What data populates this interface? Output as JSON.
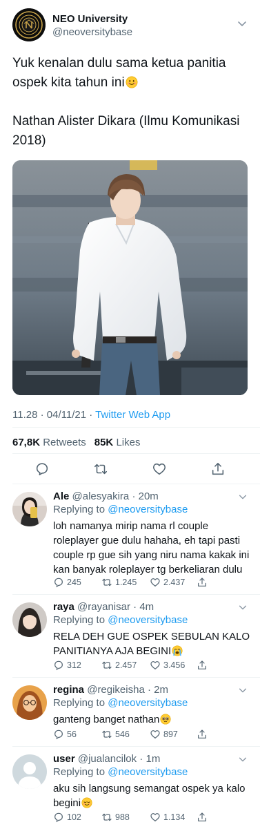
{
  "tweet": {
    "author_name": "NEO University",
    "author_handle": "@neoversitybase",
    "text_line1": "Yuk kenalan dulu sama ketua panitia ospek kita tahun ini",
    "text_line2": "Nathan Alister Dikara (Ilmu Komunikasi 2018)",
    "emoji1": "smiling-face-emoji",
    "time": "11.28",
    "date": "04/11/21",
    "app": "Twitter Web App",
    "retweets": "67,8K",
    "retweets_label": "Retweets",
    "likes": "85K",
    "likes_label": "Likes",
    "action_icons": [
      "reply-icon",
      "retweet-icon",
      "like-icon",
      "share-icon"
    ]
  },
  "replies": [
    {
      "name": "Ale",
      "handle": "@alesyakira",
      "time": "20m",
      "replying_prefix": "Replying to",
      "replying_to": "@neoversitybase",
      "text": "loh namanya mirip nama rl couple roleplayer gue dulu hahaha, eh tapi pasti couple rp gue sih yang niru nama kakak ini kan banyak roleplayer tg berkeliaran dulu",
      "emoji": "",
      "replies": "245",
      "retweets": "1.245",
      "likes": "2.437"
    },
    {
      "name": "raya",
      "handle": "@rayanisar",
      "time": "4m",
      "replying_prefix": "Replying to",
      "replying_to": "@neoversitybase",
      "text": "RELA DEH GUE OSPEK SEBULAN KALO PANITIANYA AJA BEGINI",
      "emoji": "loudly-crying-face-emoji",
      "replies": "312",
      "retweets": "2.457",
      "likes": "3.456"
    },
    {
      "name": "regina",
      "handle": "@regikeisha",
      "time": "2m",
      "replying_prefix": "Replying to",
      "replying_to": "@neoversitybase",
      "text": "ganteng banget nathan",
      "emoji": "pleading-face-emoji",
      "replies": "56",
      "retweets": "546",
      "likes": "897"
    },
    {
      "name": "user",
      "handle": "@jualancilok",
      "time": "1m",
      "replying_prefix": "Replying to",
      "replying_to": "@neoversitybase",
      "text": "aku sih langsung semangat ospek ya kalo begini",
      "emoji": "relieved-face-emoji",
      "replies": "102",
      "retweets": "988",
      "likes": "1.134"
    }
  ],
  "colors": {
    "text": "#0f1419",
    "secondary": "#536471",
    "link": "#1d9bf0",
    "divider": "#eff3f4"
  }
}
